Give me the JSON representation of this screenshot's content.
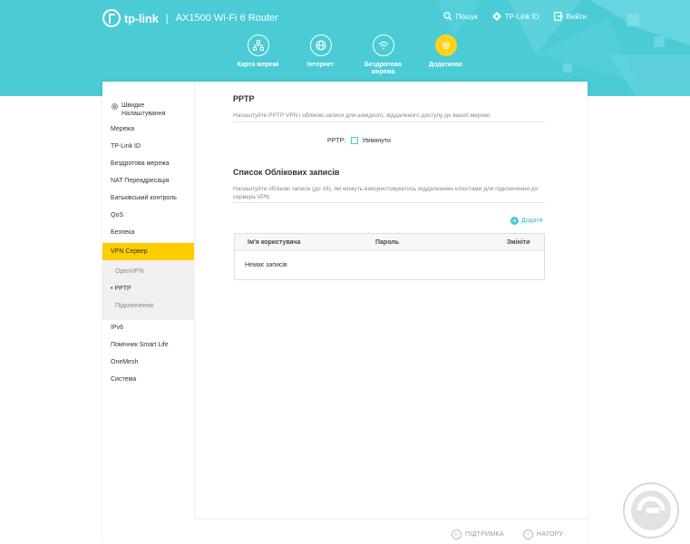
{
  "header": {
    "brand": "tp-link",
    "separator": "|",
    "model": "AX1500 Wi-Fi 6 Router",
    "links": [
      {
        "label": "Пошук",
        "icon": "search-icon"
      },
      {
        "label": "TP-Link ID",
        "icon": "user-id-icon"
      },
      {
        "label": "Вийти",
        "icon": "logout-icon"
      }
    ],
    "nav": [
      {
        "label": "Карта мережі",
        "icon": "network-map-icon"
      },
      {
        "label": "Інтернет",
        "icon": "globe-icon"
      },
      {
        "label": "Бездротова мережа",
        "icon": "wifi-icon"
      },
      {
        "label": "Додатково",
        "icon": "gear-icon",
        "active": true
      }
    ]
  },
  "sidebar": {
    "quick_setup": "Швидке Налаштування",
    "items": [
      "Мережа",
      "TP-Link ID",
      "Бездротова мережа",
      "NAT Переадресація",
      "Батьківський контроль",
      "QoS",
      "Безпека",
      "VPN Сервер"
    ],
    "sub_items": [
      "OpenVPN",
      "• PPTP",
      "Підключення"
    ],
    "items_after": [
      "IPv6",
      "Помічник Smart Life",
      "OneMesh",
      "Система"
    ]
  },
  "main": {
    "pptp_title": "PPTP",
    "pptp_desc": "Налаштуйте PPTP VPN і облікові записи для швидкого, віддаленого доступу до вашої мережі.",
    "pptp_label": "PPTP:",
    "pptp_checkbox_label": "Увімкнути",
    "accounts_title": "Список Облікових записів",
    "accounts_desc": "Налаштуйте облікові записи (до 16), які можуть використовуватись віддаленими клієнтами для підключення до сервера VPN.",
    "add_label": "Додати",
    "table": {
      "columns": [
        "Ім'я користувача",
        "Пароль",
        "Змініти"
      ],
      "empty": "Немає записів"
    }
  },
  "footer": {
    "support": "ПІДТРИМКА",
    "top": "НАГОРУ"
  },
  "colors": {
    "header": "#4acbd6",
    "accent": "#ffcc00"
  }
}
